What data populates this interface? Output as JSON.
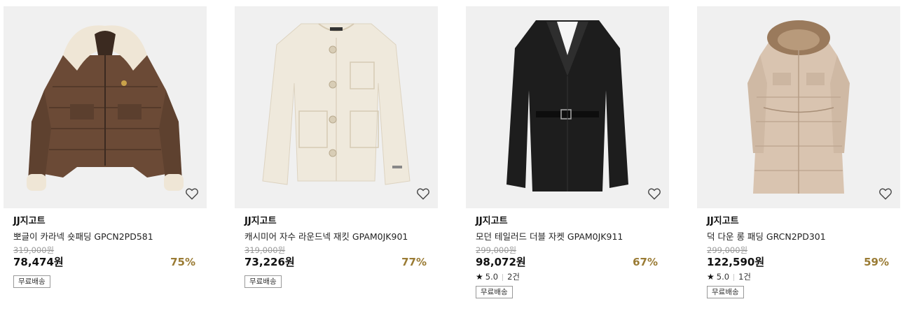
{
  "products": [
    {
      "brand": "JJ지고트",
      "name": "뽀글이 카라넥 숏패딩 GPCN2PD581",
      "original_price": "319,000원",
      "price": "78,474원",
      "discount": "75%",
      "rating": null,
      "review_count": null,
      "badge": "무료배송",
      "icon": "heart-outline-icon"
    },
    {
      "brand": "JJ지고트",
      "name": "캐시미어 자수 라운드넥 재킷 GPAM0JK901",
      "original_price": "319,000원",
      "price": "73,226원",
      "discount": "77%",
      "rating": null,
      "review_count": null,
      "badge": "무료배송",
      "icon": "heart-outline-icon"
    },
    {
      "brand": "JJ지고트",
      "name": "모던 테일러드 더블 자켓 GPAM0JK911",
      "original_price": "299,000원",
      "price": "98,072원",
      "discount": "67%",
      "rating": "5.0",
      "review_count": "2건",
      "badge": "무료배송",
      "icon": "heart-outline-icon"
    },
    {
      "brand": "JJ지고트",
      "name": "덕 다운 롱 패딩 GRCN2PD301",
      "original_price": "299,000원",
      "price": "122,590원",
      "discount": "59%",
      "rating": "5.0",
      "review_count": "1건",
      "badge": "무료배송",
      "icon": "heart-outline-icon"
    }
  ],
  "colors": {
    "discount": "#9a7b34",
    "thumb_bg": "#f0f0f0",
    "strike": "#999999"
  }
}
